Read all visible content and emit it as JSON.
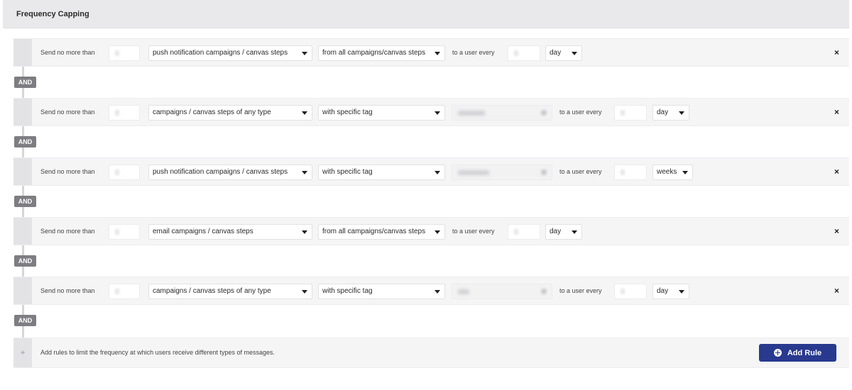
{
  "panel": {
    "title": "Frequency Capping"
  },
  "labels": {
    "send_no_more_than": "Send no more than",
    "to_a_user_every": "to a user every",
    "and": "AND",
    "remove": "×"
  },
  "rules": [
    {
      "campaign_type": "push notification campaigns / canvas steps",
      "source": "from all campaigns/canvas steps",
      "period": "day"
    },
    {
      "campaign_type": "campaigns / canvas steps of any type",
      "source": "with specific tag",
      "period": "day"
    },
    {
      "campaign_type": "push notification campaigns / canvas steps",
      "source": "with specific tag",
      "period": "weeks"
    },
    {
      "campaign_type": "email campaigns / canvas steps",
      "source": "from all campaigns/canvas steps",
      "period": "day"
    },
    {
      "campaign_type": "campaigns / canvas steps of any type",
      "source": "with specific tag",
      "period": "day"
    }
  ],
  "add_rule": {
    "plus": "+",
    "hint": "Add rules to limit the frequency at which users receive different types of messages.",
    "button_label": "Add Rule"
  },
  "colors": {
    "primary_button": "#28398e",
    "and_badge": "#7d7d82"
  }
}
